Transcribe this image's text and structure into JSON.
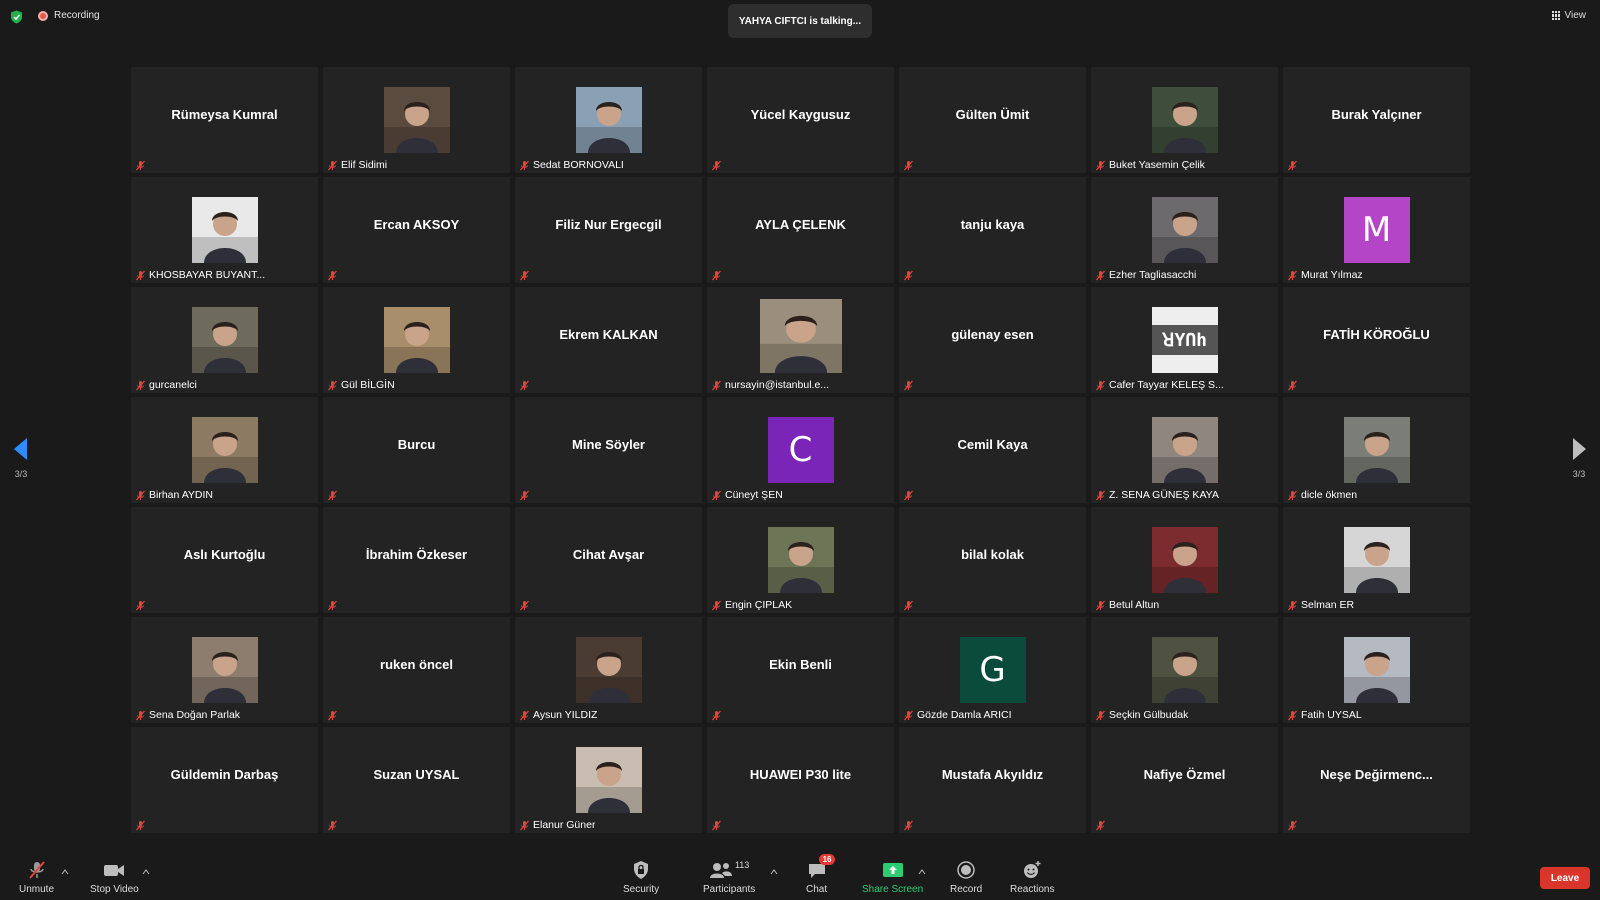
{
  "top": {
    "recording_label": "Recording",
    "talking": "YAHYA CIFTCI is talking...",
    "view_label": "View"
  },
  "nav": {
    "left_page": "3/3",
    "right_page": "3/3"
  },
  "participants": [
    {
      "name": "Rümeysa Kumral",
      "kind": "name"
    },
    {
      "name": "Elif Sidimi",
      "kind": "photo",
      "tone": "#5b4a3e"
    },
    {
      "name": "Sedat BORNOVALI",
      "kind": "photo",
      "tone": "#8aa0b4"
    },
    {
      "name": "Yücel Kaygusuz",
      "kind": "name"
    },
    {
      "name": "Gülten Ümit",
      "kind": "name"
    },
    {
      "name": "Buket Yasemin Çelik",
      "kind": "photo",
      "tone": "#3f4d3c"
    },
    {
      "name": "Burak Yalçıner",
      "kind": "name"
    },
    {
      "name": "KHOSBAYAR BUYANT...",
      "kind": "photo",
      "tone": "#e9e9e9"
    },
    {
      "name": "Ercan AKSOY",
      "kind": "name"
    },
    {
      "name": "Filiz Nur Ergecgil",
      "kind": "name"
    },
    {
      "name": "AYLA ÇELENK",
      "kind": "name"
    },
    {
      "name": "tanju kaya",
      "kind": "name"
    },
    {
      "name": "Ezher Tagliasacchi",
      "kind": "photo",
      "tone": "#6d6a6e"
    },
    {
      "name": "Murat Yılmaz",
      "kind": "letter",
      "letter": "M",
      "color": "#b545c7"
    },
    {
      "name": "gurcanelci",
      "kind": "photo",
      "tone": "#6e6a5c"
    },
    {
      "name": "Gül BİLGİN",
      "kind": "photo",
      "tone": "#a98e6c"
    },
    {
      "name": "Ekrem  KALKAN",
      "kind": "name"
    },
    {
      "name": "nursayin@istanbul.e...",
      "kind": "photo-wide",
      "tone": "#9a8f7c"
    },
    {
      "name": "gülenay esen",
      "kind": "name"
    },
    {
      "name": "Cafer Tayyar KELEŞ S...",
      "kind": "logo",
      "logo_text": "ꓤYՈh"
    },
    {
      "name": "FATİH KÖROĞLU",
      "kind": "name"
    },
    {
      "name": "Birhan AYDIN",
      "kind": "photo",
      "tone": "#8c7a62"
    },
    {
      "name": "Burcu",
      "kind": "name"
    },
    {
      "name": "Mine Söyler",
      "kind": "name"
    },
    {
      "name": "Cüneyt ŞEN",
      "kind": "letter",
      "letter": "C",
      "color": "#7a25b8"
    },
    {
      "name": "Cemil Kaya",
      "kind": "name"
    },
    {
      "name": "Z. SENA GÜNEŞ KAYA",
      "kind": "photo",
      "tone": "#8f8680"
    },
    {
      "name": "dicle ökmen",
      "kind": "photo",
      "tone": "#7a7e76"
    },
    {
      "name": "Aslı Kurtoğlu",
      "kind": "name"
    },
    {
      "name": "İbrahim Özkeser",
      "kind": "name"
    },
    {
      "name": "Cihat Avşar",
      "kind": "name"
    },
    {
      "name": "Engin ÇIPLAK",
      "kind": "photo",
      "tone": "#6d7556"
    },
    {
      "name": "bilal kolak",
      "kind": "name"
    },
    {
      "name": "Betul Altun",
      "kind": "photo",
      "tone": "#7c2b2f"
    },
    {
      "name": "Selman ER",
      "kind": "photo",
      "tone": "#d6d6d6"
    },
    {
      "name": "Sena Doğan Parlak",
      "kind": "photo",
      "tone": "#8c7d6f"
    },
    {
      "name": "ruken öncel",
      "kind": "name"
    },
    {
      "name": "Aysun YILDIZ",
      "kind": "photo",
      "tone": "#4a3b33"
    },
    {
      "name": "Ekin Benli",
      "kind": "name"
    },
    {
      "name": "Gözde Damla ARICI",
      "kind": "letter",
      "letter": "G",
      "color": "#0b4b3c"
    },
    {
      "name": "Seçkin Gülbudak",
      "kind": "photo",
      "tone": "#4e5040"
    },
    {
      "name": "Fatih UYSAL",
      "kind": "photo",
      "tone": "#b5b9c2"
    },
    {
      "name": "Güldemin Darbaş",
      "kind": "name"
    },
    {
      "name": "Suzan UYSAL",
      "kind": "name"
    },
    {
      "name": "Elanur Güner",
      "kind": "photo",
      "tone": "#c9bdb1"
    },
    {
      "name": "HUAWEI P30 lite",
      "kind": "name"
    },
    {
      "name": "Mustafa Akyıldız",
      "kind": "name"
    },
    {
      "name": "Nafiye Özmel",
      "kind": "name"
    },
    {
      "name": "Neşe  Değirmenc...",
      "kind": "name"
    }
  ],
  "toolbar": {
    "unmute": "Unmute",
    "stop_video": "Stop Video",
    "security": "Security",
    "participants": "Participants",
    "participants_count": "113",
    "chat": "Chat",
    "chat_badge": "16",
    "share_screen": "Share Screen",
    "record": "Record",
    "reactions": "Reactions",
    "leave": "Leave"
  },
  "colors": {
    "background": "#1a1a1a",
    "tile": "#232323",
    "mute_red": "#e0443c",
    "share_green": "#2ecc71",
    "leave_red": "#d9352b",
    "nav_blue": "#2d8cff"
  }
}
